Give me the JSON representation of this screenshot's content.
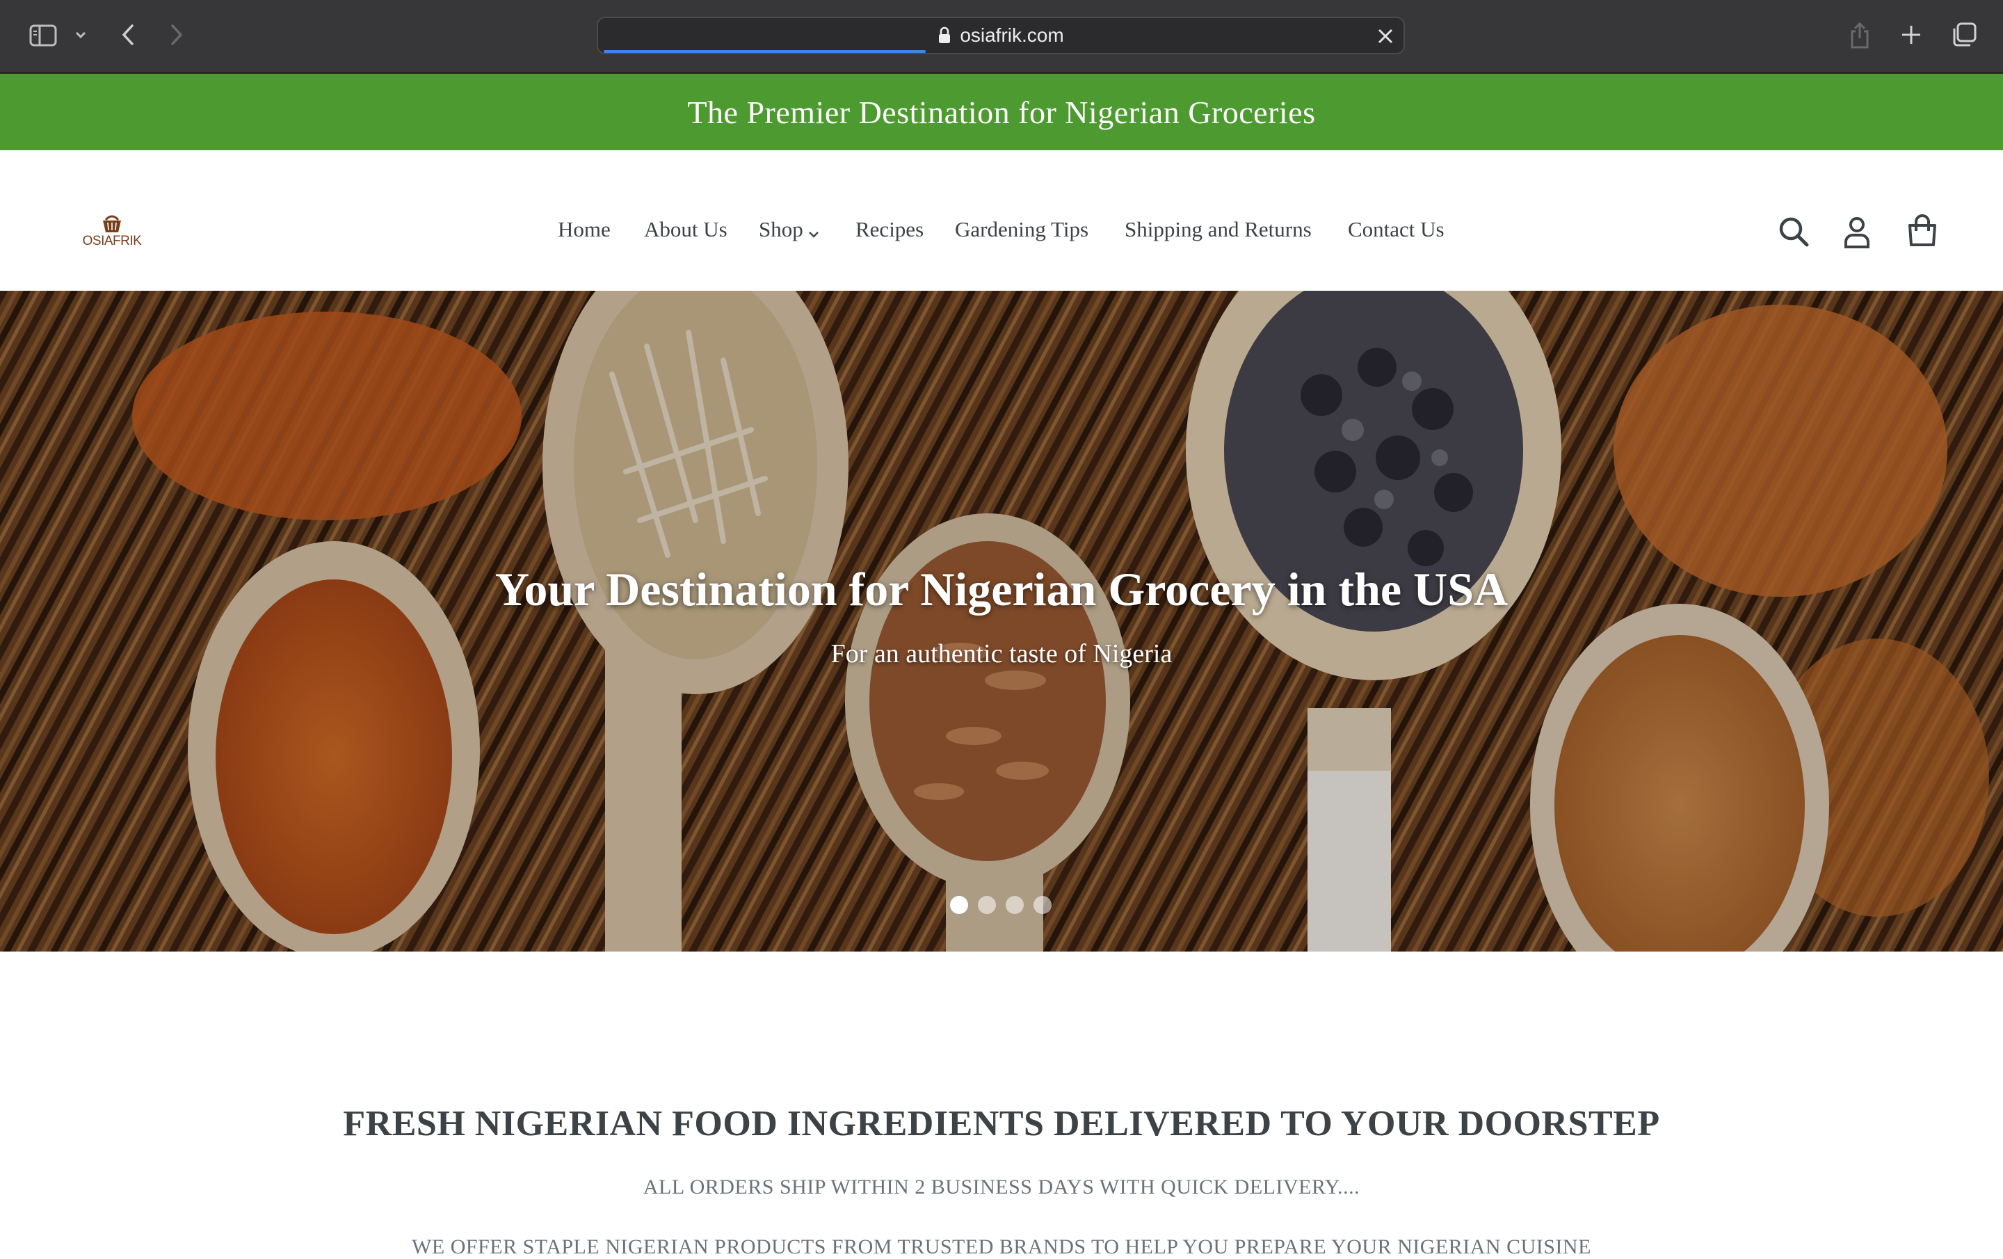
{
  "browser": {
    "url": "osiafrik.com",
    "load_progress": 0.4,
    "accent": "#3a86f5"
  },
  "announcement": {
    "text": "The Premier Destination for Nigerian Groceries",
    "color": "#4d9a31"
  },
  "header": {
    "logo_text": "OSIAFRIK",
    "nav": [
      {
        "label": "Home"
      },
      {
        "label": "About Us"
      },
      {
        "label": "Shop",
        "has_dropdown": true
      },
      {
        "label": "Recipes"
      },
      {
        "label": "Gardening Tips"
      },
      {
        "label": "Shipping and Returns"
      },
      {
        "label": "Contact Us"
      }
    ],
    "icons": [
      "search-icon",
      "account-icon",
      "cart-icon"
    ]
  },
  "hero": {
    "title": "Your Destination for Nigerian Grocery in the USA",
    "subtitle": "For an authentic taste of Nigeria",
    "slide_count": 4,
    "active_slide": 1
  },
  "intro": {
    "heading": "FRESH NIGERIAN FOOD INGREDIENTS DELIVERED TO YOUR DOORSTEP",
    "line1": "ALL ORDERS SHIP WITHIN 2 BUSINESS DAYS WITH QUICK DELIVERY....",
    "line2": "WE OFFER STAPLE NIGERIAN PRODUCTS FROM TRUSTED BRANDS TO HELP YOU PREPARE YOUR NIGERIAN CUISINE"
  }
}
